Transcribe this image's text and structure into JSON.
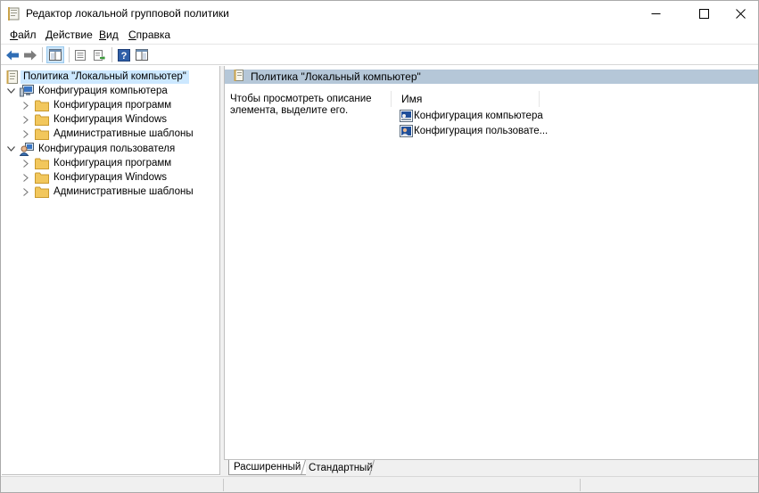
{
  "window": {
    "title": "Редактор локальной групповой политики"
  },
  "menu": [
    {
      "label_acc": "Ф",
      "label_rest": "айл"
    },
    {
      "label_acc": "Д",
      "label_rest": "ействие"
    },
    {
      "label_acc": "В",
      "label_rest": "ид"
    },
    {
      "label_acc": "С",
      "label_rest": "правка"
    }
  ],
  "tree": {
    "root": "Политика \"Локальный компьютер\"",
    "computer_config": "Конфигурация компьютера",
    "user_config": "Конфигурация пользователя",
    "computer_children": [
      "Конфигурация программ",
      "Конфигурация Windows",
      "Административные шаблоны"
    ],
    "user_children": [
      "Конфигурация программ",
      "Конфигурация Windows",
      "Административные шаблоны"
    ]
  },
  "details": {
    "header_title": "Политика \"Локальный компьютер\"",
    "description": "Чтобы просмотреть описание элемента, выделите его.",
    "column_name": "Имя",
    "items": [
      "Конфигурация компьютера",
      "Конфигурация пользовате..."
    ]
  },
  "tabs": {
    "extended": "Расширенный",
    "standard": "Стандартный"
  },
  "colors": {
    "header_bar": "#b5c7d8",
    "selection": "#cce8ff",
    "folder": "#e8b84a",
    "arrow": "#2f6db5"
  }
}
